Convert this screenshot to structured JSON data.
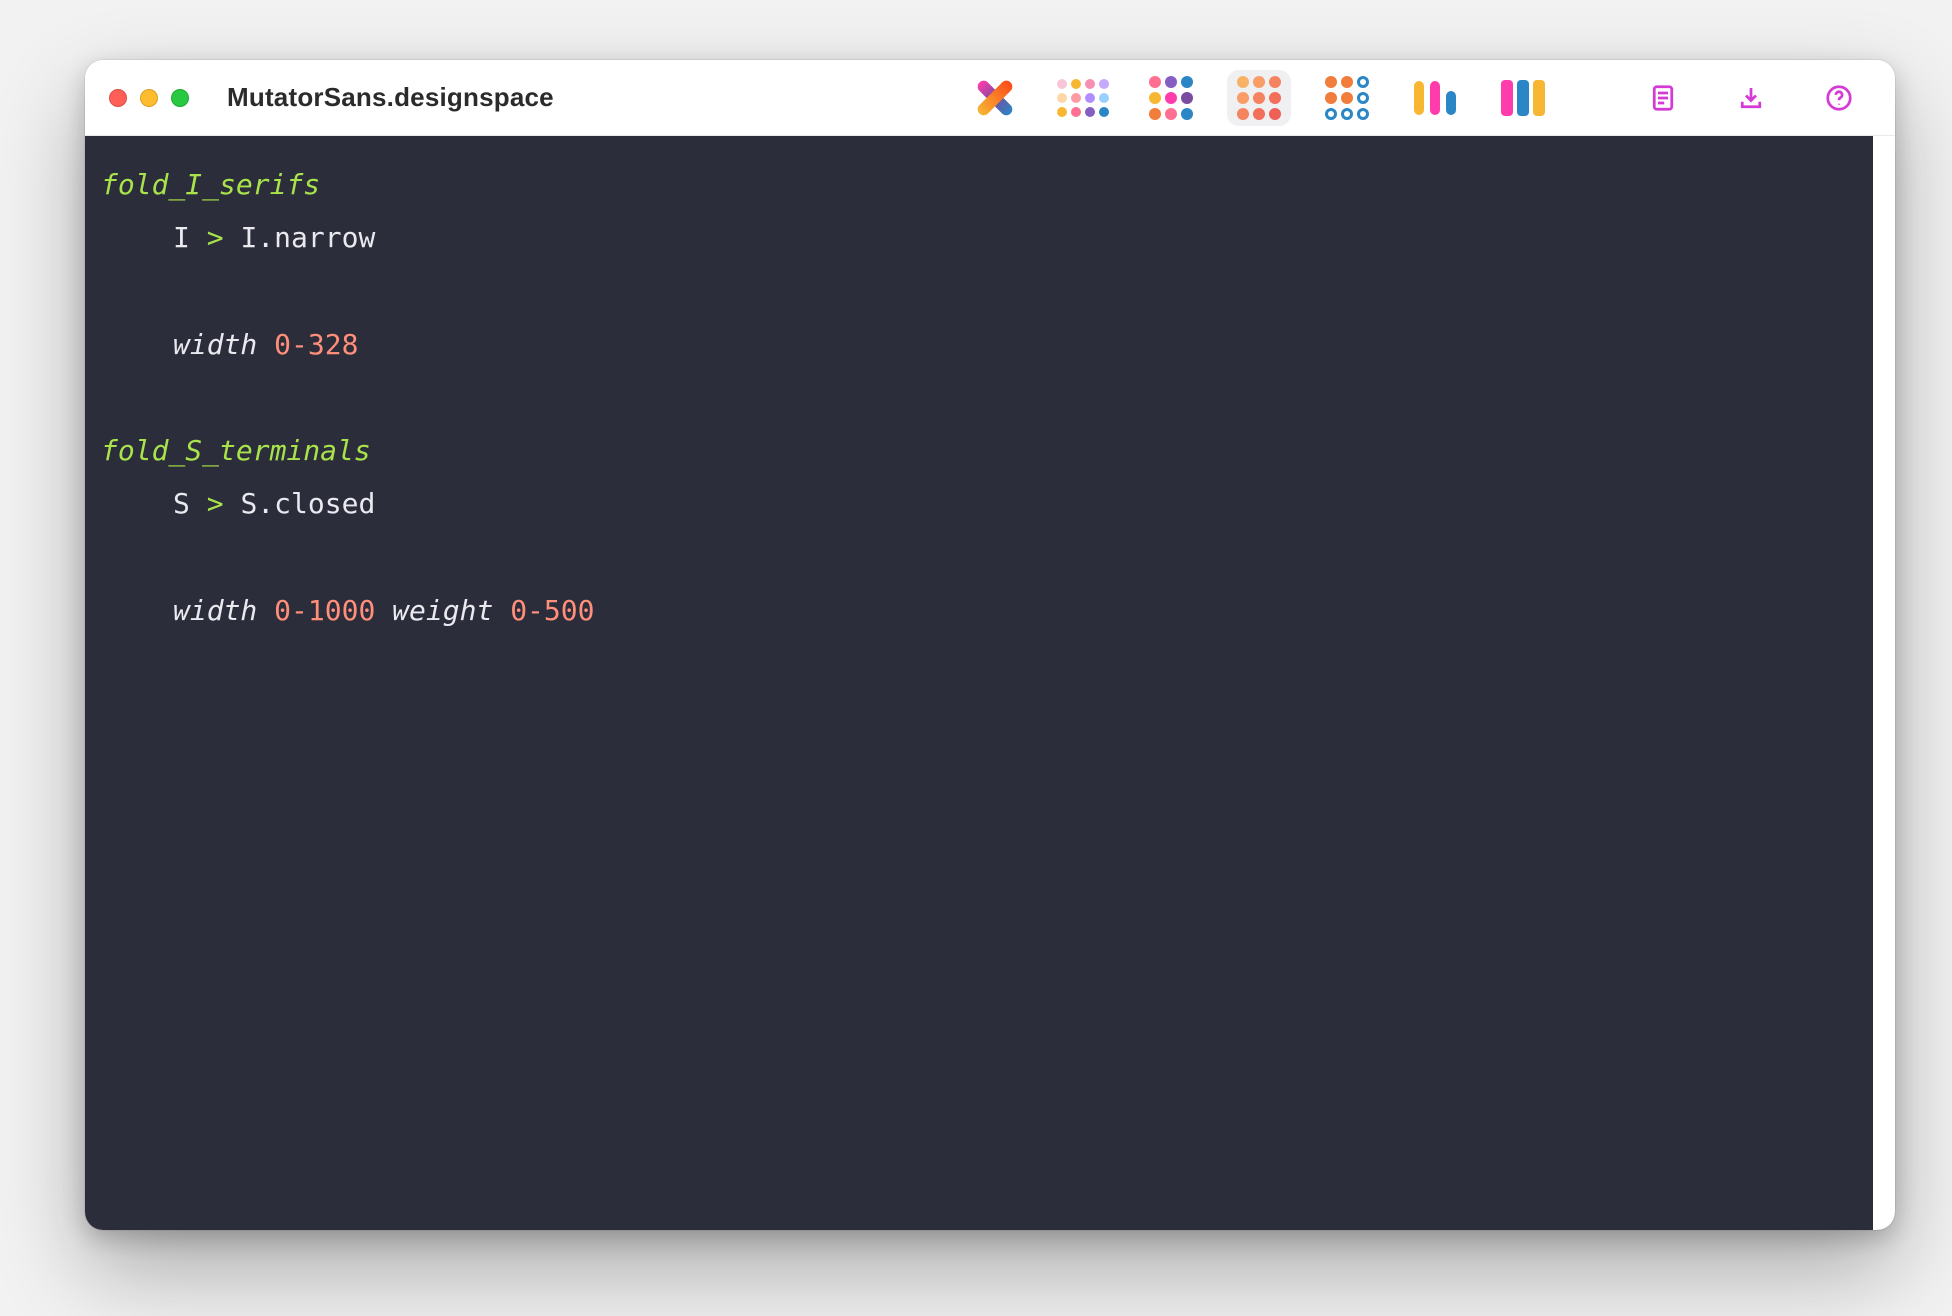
{
  "window": {
    "title": "MutatorSans.designspace"
  },
  "toolbar": {
    "items": [
      {
        "name": "logo-x",
        "active": false
      },
      {
        "name": "grid-pastel",
        "active": false
      },
      {
        "name": "grid-color",
        "active": false
      },
      {
        "name": "grid-orange",
        "active": true
      },
      {
        "name": "grid-hollow",
        "active": false
      },
      {
        "name": "bars",
        "active": false
      },
      {
        "name": "panels",
        "active": false
      }
    ],
    "right": [
      {
        "name": "document-icon"
      },
      {
        "name": "download-icon"
      },
      {
        "name": "help-icon"
      }
    ]
  },
  "code": {
    "rules": [
      {
        "name": "fold_I_serifs",
        "sub": {
          "from": "I",
          "arrow": ">",
          "to": "I.narrow"
        },
        "conditions": [
          {
            "axis": "width",
            "range": "0-328"
          }
        ]
      },
      {
        "name": "fold_S_terminals",
        "sub": {
          "from": "S",
          "arrow": ">",
          "to": "S.closed"
        },
        "conditions": [
          {
            "axis": "width",
            "range": "0-1000"
          },
          {
            "axis": "weight",
            "range": "0-500"
          }
        ]
      }
    ]
  },
  "colors": {
    "editor_bg": "#2b2d3a",
    "rule_name": "#a9e34b",
    "range": "#ff8f7a",
    "text": "#e9e9ef",
    "accent": "#d63ad6"
  }
}
